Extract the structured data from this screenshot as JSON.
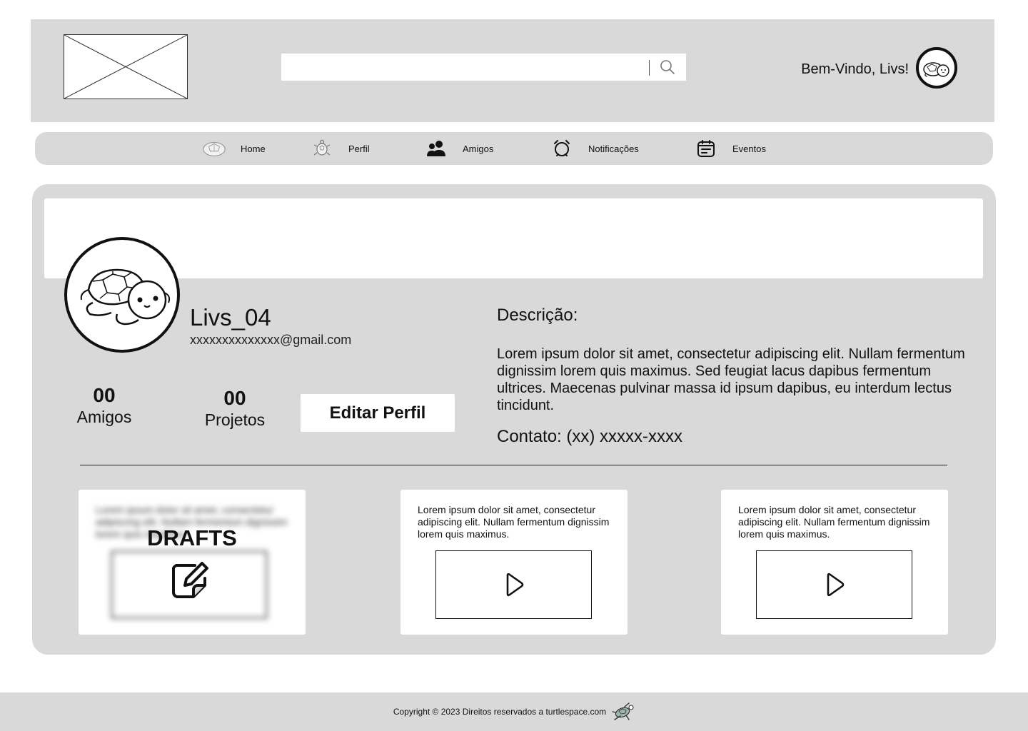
{
  "header": {
    "logo_icon": "image-placeholder-icon",
    "search": {
      "value": "",
      "placeholder": "",
      "icon": "search-icon"
    },
    "welcome_text": "Bem-Vindo, Livs!",
    "avatar_icon": "turtle-avatar-icon"
  },
  "nav": {
    "items": [
      {
        "label": "Home",
        "icon": "turtle-shell-icon"
      },
      {
        "label": "Perfil",
        "icon": "turtle-icon"
      },
      {
        "label": "Amigos",
        "icon": "people-icon"
      },
      {
        "label": "Notificações",
        "icon": "alarm-clock-icon"
      },
      {
        "label": "Eventos",
        "icon": "calendar-icon"
      }
    ]
  },
  "profile": {
    "username": "Livs_04",
    "email": "xxxxxxxxxxxxxx@gmail.com",
    "stats": {
      "friends": {
        "value": "00",
        "label": "Amigos"
      },
      "projects": {
        "value": "00",
        "label": "Projetos"
      }
    },
    "edit_button": "Editar Perfil",
    "description_title": "Descrição:",
    "description_text": "Lorem ipsum dolor sit amet, consectetur adipiscing elit. Nullam fermentum dignissim lorem quis maximus. Sed feugiat lacus dapibus fermentum ultrices. Maecenas pulvinar massa id ipsum dapibus, eu interdum lectus tincidunt.",
    "contact": "Contato: (xx) xxxxx-xxxx"
  },
  "cards": {
    "drafts": {
      "title": "DRAFTS",
      "text": "Lorem ipsum dolor sit amet, consectetur adipiscing elit. Nullam fermentum dignissim lorem quis maximus.",
      "icon": "edit-note-icon"
    },
    "projects": [
      {
        "text": "Lorem ipsum dolor sit amet, consectetur adipiscing elit. Nullam fermentum dignissim lorem quis maximus.",
        "icon": "play-icon"
      },
      {
        "text": "Lorem ipsum dolor sit amet, consectetur adipiscing elit. Nullam fermentum dignissim lorem quis maximus.",
        "icon": "play-icon"
      }
    ]
  },
  "footer": {
    "text": "Copyright © 2023 Direitos reservados a turtlespace.com",
    "icon": "sea-turtle-icon"
  },
  "colors": {
    "panel": "#d9d9d9",
    "surface": "#ffffff",
    "text": "#111111"
  }
}
